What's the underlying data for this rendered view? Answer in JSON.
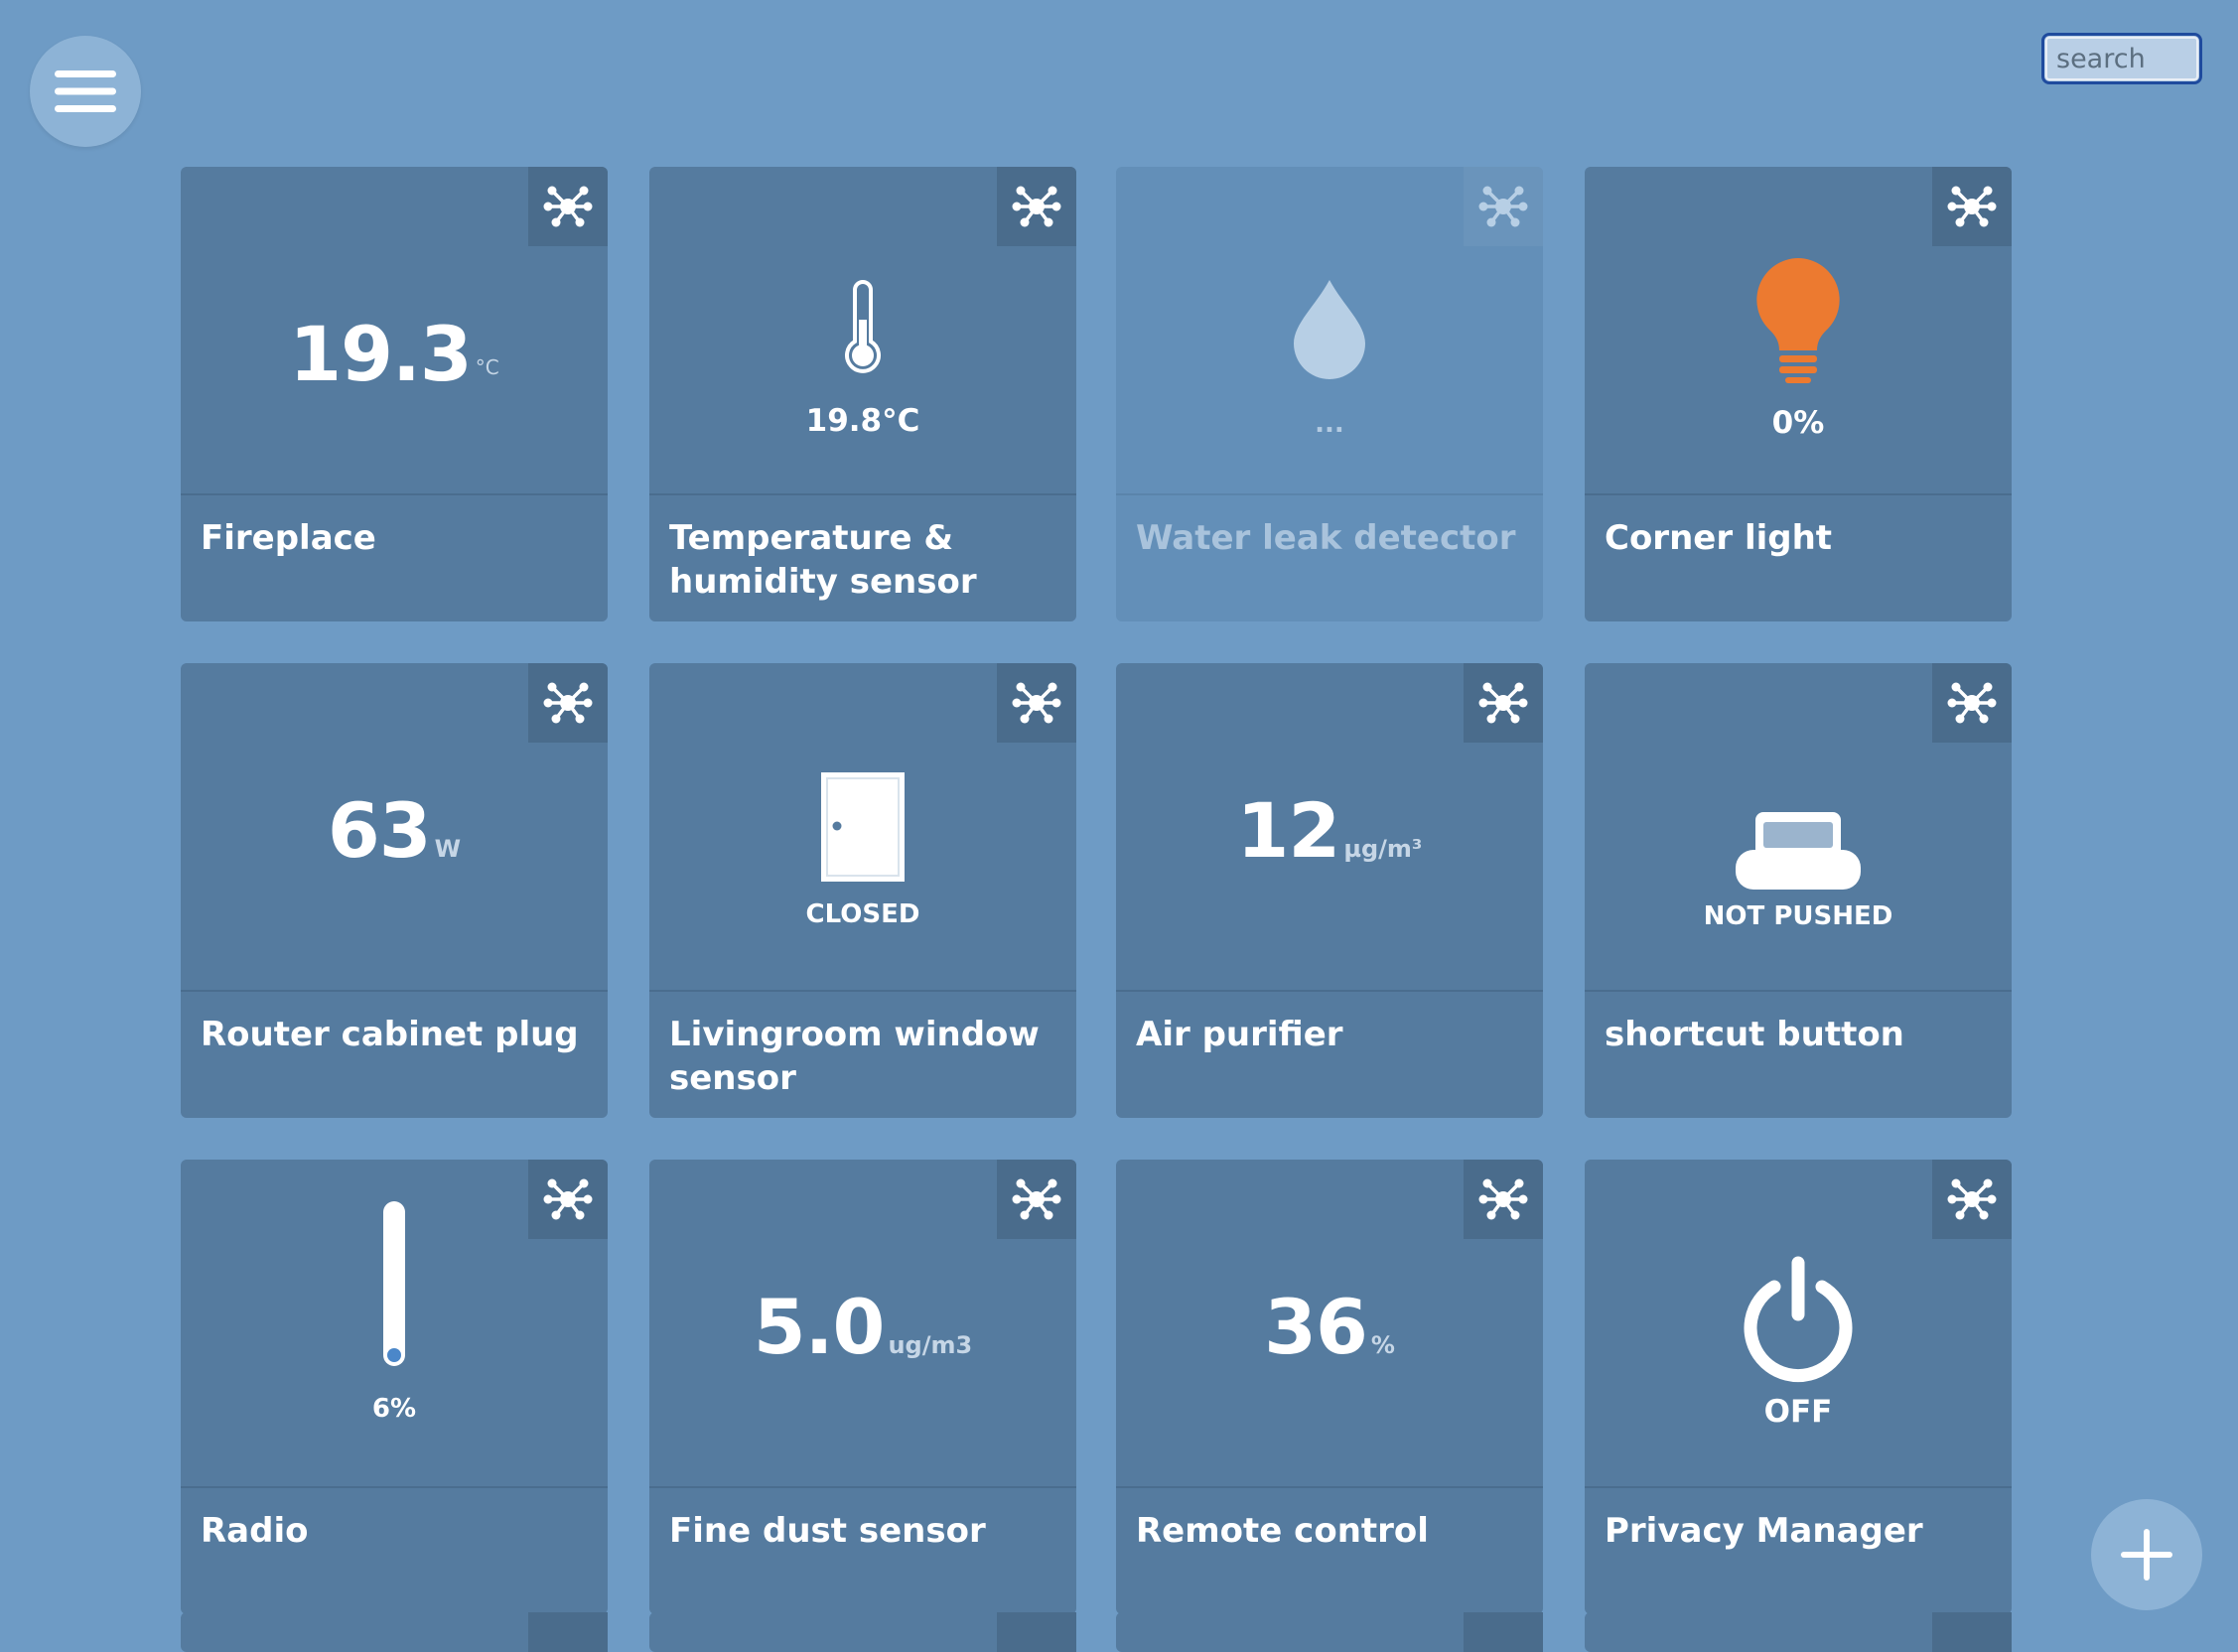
{
  "header": {
    "search_placeholder": "search",
    "menu_icon": "hamburger-menu-icon"
  },
  "tiles": [
    {
      "name": "Fireplace",
      "value": "19.3",
      "unit": "°C",
      "type": "number"
    },
    {
      "name": "Temperature & humidity sensor",
      "name_line1": "Temperature &",
      "name_line2": "humidity sensor",
      "value": "19.8°C",
      "icon": "thermometer-icon",
      "type": "icon"
    },
    {
      "name": "Water leak detector",
      "value": "...",
      "icon": "water-drop-icon",
      "type": "icon",
      "status": "unavailable"
    },
    {
      "name": "Corner light",
      "value": "0%",
      "icon": "light-bulb-icon",
      "icon_color": "#ec7a30",
      "type": "icon"
    },
    {
      "name": "Router cabinet plug",
      "value": "63",
      "unit": "W",
      "type": "number"
    },
    {
      "name": "Livingroom window sensor",
      "name_line1": "Livingroom window",
      "name_line2": "sensor",
      "value": "CLOSED",
      "icon": "door-icon",
      "type": "icon"
    },
    {
      "name": "Air purifier",
      "value": "12",
      "unit": "µg/m³",
      "type": "number"
    },
    {
      "name": "shortcut button",
      "value": "NOT PUSHED",
      "icon": "push-button-icon",
      "type": "icon"
    },
    {
      "name": "Radio",
      "value": "6%",
      "level": 0.06,
      "icon": "volume-slider-icon",
      "type": "icon"
    },
    {
      "name": "Fine dust sensor",
      "value": "5.0",
      "unit": "ug/m3",
      "type": "number"
    },
    {
      "name": "Remote control",
      "value": "36",
      "unit": "%",
      "type": "number"
    },
    {
      "name": "Privacy Manager",
      "value": "OFF",
      "icon": "power-icon",
      "type": "icon"
    }
  ],
  "colors": {
    "background": "#6e9bc5",
    "tile": "#557b9f",
    "tile_unavailable": "#638fb8",
    "accent_light": "#ec7a30"
  },
  "icons": {
    "connection": "network-hub-icon",
    "add": "plus-icon"
  }
}
